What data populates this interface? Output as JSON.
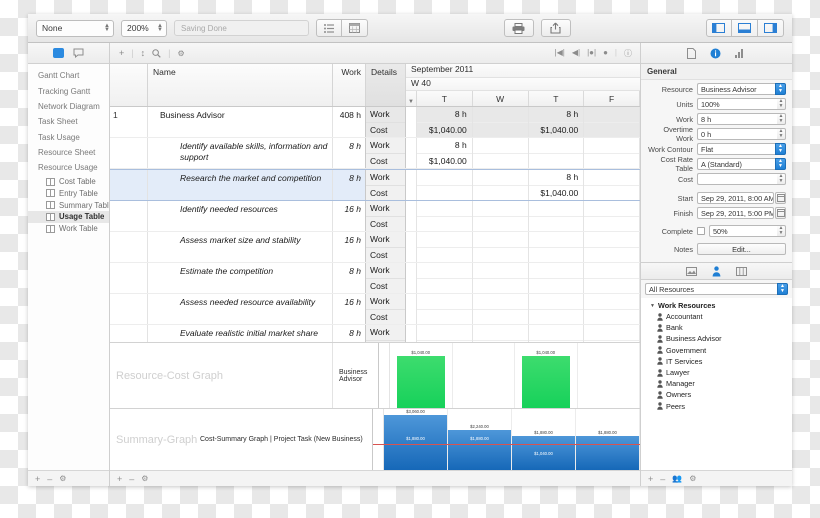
{
  "toolbar": {
    "filter_value": "None",
    "zoom_value": "200%",
    "status_text": "Saving Done",
    "icons": [
      "list-icon",
      "calendar-icon",
      "print-icon",
      "share-icon",
      "left-panel-icon",
      "bottom-panel-icon",
      "right-panel-icon"
    ]
  },
  "sidebar": {
    "views": [
      {
        "label": "Gantt Chart"
      },
      {
        "label": "Tracking Gantt"
      },
      {
        "label": "Network Diagram"
      },
      {
        "label": "Task Sheet"
      },
      {
        "label": "Task Usage"
      },
      {
        "label": "Resource Sheet"
      },
      {
        "label": "Resource Usage"
      }
    ],
    "tables": [
      {
        "label": "Cost Table",
        "selected": false
      },
      {
        "label": "Entry Table",
        "selected": false
      },
      {
        "label": "Summary Table",
        "selected": false
      },
      {
        "label": "Usage Table",
        "selected": true
      },
      {
        "label": "Work Table",
        "selected": false
      }
    ]
  },
  "table": {
    "headers": {
      "id": "",
      "name": "Name",
      "work": "Work",
      "details": "Details"
    },
    "timescale": {
      "month": "September 2011",
      "week": "W 40",
      "days": [
        "T",
        "W",
        "T",
        "F"
      ]
    },
    "rows": [
      {
        "id": "1",
        "name": "Business Advisor",
        "work": "408 h",
        "indent": 1,
        "italic": false,
        "group": true,
        "selected": false,
        "work_values": [
          "8 h",
          "",
          "8 h",
          ""
        ],
        "cost_values": [
          "$1,040.00",
          "",
          "$1,040.00",
          ""
        ]
      },
      {
        "id": "",
        "name": "Identify available skills, information and support",
        "work": "8 h",
        "indent": 2,
        "italic": true,
        "group": false,
        "selected": false,
        "work_values": [
          "8 h",
          "",
          "",
          ""
        ],
        "cost_values": [
          "$1,040.00",
          "",
          "",
          ""
        ]
      },
      {
        "id": "",
        "name": "Research the market and competition",
        "work": "8 h",
        "indent": 2,
        "italic": true,
        "group": false,
        "selected": true,
        "work_values": [
          "",
          "",
          "8 h",
          ""
        ],
        "cost_values": [
          "",
          "",
          "$1,040.00",
          ""
        ]
      },
      {
        "id": "",
        "name": "Identify needed resources",
        "work": "16 h",
        "indent": 2,
        "italic": true,
        "group": false,
        "selected": false,
        "work_values": [
          "",
          "",
          "",
          ""
        ],
        "cost_values": [
          "",
          "",
          "",
          ""
        ]
      },
      {
        "id": "",
        "name": "Assess market size and stability",
        "work": "16 h",
        "indent": 2,
        "italic": true,
        "group": false,
        "selected": false,
        "work_values": [
          "",
          "",
          "",
          ""
        ],
        "cost_values": [
          "",
          "",
          "",
          ""
        ]
      },
      {
        "id": "",
        "name": "Estimate the competition",
        "work": "8 h",
        "indent": 2,
        "italic": true,
        "group": false,
        "selected": false,
        "work_values": [
          "",
          "",
          "",
          ""
        ],
        "cost_values": [
          "",
          "",
          "",
          ""
        ]
      },
      {
        "id": "",
        "name": "Assess needed resource availability",
        "work": "16 h",
        "indent": 2,
        "italic": true,
        "group": false,
        "selected": false,
        "work_values": [
          "",
          "",
          "",
          ""
        ],
        "cost_values": [
          "",
          "",
          "",
          ""
        ]
      },
      {
        "id": "",
        "name": "Evaluate realistic initial market share",
        "work": "8 h",
        "indent": 2,
        "italic": true,
        "group": false,
        "selected": false,
        "work_values": [
          "",
          "",
          "",
          ""
        ],
        "cost_values": [
          "",
          "",
          "",
          ""
        ]
      }
    ],
    "row_detail_labels": [
      "Work",
      "Cost"
    ]
  },
  "chart_data": [
    {
      "type": "bar",
      "title": "Resource-Cost Graph",
      "legend": "Business Advisor",
      "categories": [
        "T",
        "W",
        "T",
        "F"
      ],
      "values": [
        1040,
        0,
        1040,
        0
      ],
      "labels": [
        "$1,040.00",
        "",
        "$1,040.00",
        ""
      ],
      "color": "#17d15a",
      "ylabel": "",
      "xlabel": "",
      "ylim": [
        0,
        1300
      ],
      "grid": true
    },
    {
      "type": "bar",
      "title": "Summary-Graph",
      "legend": "Cost-Summary Graph | Project Task (New Business)",
      "categories": [
        "T",
        "W",
        "T",
        "F"
      ],
      "values": [
        3060,
        2240,
        1880,
        1880
      ],
      "labels": [
        "$3,060.00",
        "$2,240.00",
        "$1,880.00",
        "$1,880.00"
      ],
      "inner_values": [
        1880,
        1880,
        1040,
        1040
      ],
      "inner_labels": [
        "$1,880.00",
        "$1,880.00",
        "$1,040.00",
        ""
      ],
      "color": "#2277c8",
      "trendline_color": "#d9534f",
      "ylabel": "",
      "xlabel": "",
      "ylim": [
        0,
        3400
      ],
      "grid": true
    }
  ],
  "inspector": {
    "section_title": "General",
    "fields": [
      {
        "label": "Resource",
        "value": "Business Advisor",
        "control": "popup"
      },
      {
        "label": "Units",
        "value": "100%",
        "control": "stepper"
      },
      {
        "label": "Work",
        "value": "8 h",
        "control": "stepper"
      },
      {
        "label": "Overtime Work",
        "value": "0 h",
        "control": "stepper"
      },
      {
        "label": "Work Contour",
        "value": "Flat",
        "control": "popup"
      },
      {
        "label": "Cost Rate Table",
        "value": "A (Standard)",
        "control": "popup"
      },
      {
        "label": "Cost",
        "value": "",
        "control": "stepper"
      },
      {
        "label": "Start",
        "value": "Sep 29, 2011, 8:00 AM",
        "control": "date"
      },
      {
        "label": "Finish",
        "value": "Sep 29, 2011, 5:00 PM",
        "control": "date"
      },
      {
        "label": "Complete",
        "value": "50%",
        "control": "checkbox-stepper"
      },
      {
        "label": "Notes",
        "value": "Edit...",
        "control": "button"
      }
    ],
    "tab_icons": [
      "document-icon",
      "info-icon",
      "chart-icon"
    ]
  },
  "resources": {
    "pane_tab_icons": [
      "image-icon",
      "person-icon",
      "columns-icon"
    ],
    "filter_value": "All Resources",
    "group_label": "Work Resources",
    "items": [
      {
        "label": "Accountant"
      },
      {
        "label": "Bank"
      },
      {
        "label": "Business Advisor"
      },
      {
        "label": "Government"
      },
      {
        "label": "IT Services"
      },
      {
        "label": "Lawyer"
      },
      {
        "label": "Manager"
      },
      {
        "label": "Owners"
      },
      {
        "label": "Peers"
      }
    ]
  },
  "footers": {
    "add": "+",
    "remove": "–",
    "settings": "⚙"
  },
  "view_header": {
    "icons": [
      "plus-icon",
      "sort-icon",
      "search-icon",
      "gear-icon"
    ],
    "nav_icons": [
      "go-start-icon",
      "go-prev-icon",
      "go-center-icon",
      "zoom-icon",
      "info-icon"
    ]
  }
}
